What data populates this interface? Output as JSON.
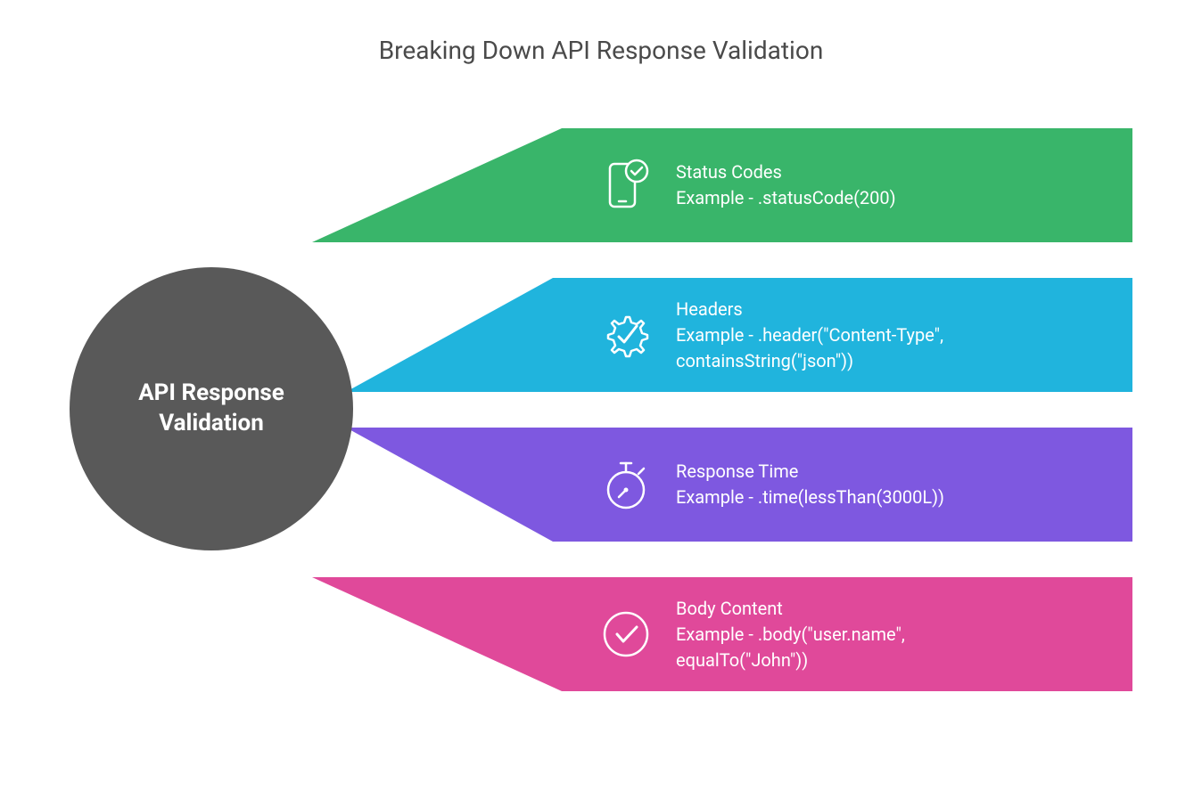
{
  "title": "Breaking Down API Response Validation",
  "center": {
    "label": "API Response\nValidation"
  },
  "colors": {
    "circle": "#595959",
    "b1": "#39b56a",
    "b2": "#20b4dd",
    "b3": "#7e58e0",
    "b4": "#e0499a"
  },
  "branches": [
    {
      "title": "Status Codes",
      "example": "Example - .statusCode(200)",
      "icon": "phone-check"
    },
    {
      "title": "Headers",
      "example": "Example - .header(\"Content-Type\", containsString(\"json\"))",
      "icon": "gear-check"
    },
    {
      "title": "Response Time",
      "example": "Example - .time(lessThan(3000L))",
      "icon": "stopwatch"
    },
    {
      "title": "Body Content",
      "example": "Example - .body(\"user.name\", equalTo(\"John\"))",
      "icon": "circle-check"
    }
  ]
}
